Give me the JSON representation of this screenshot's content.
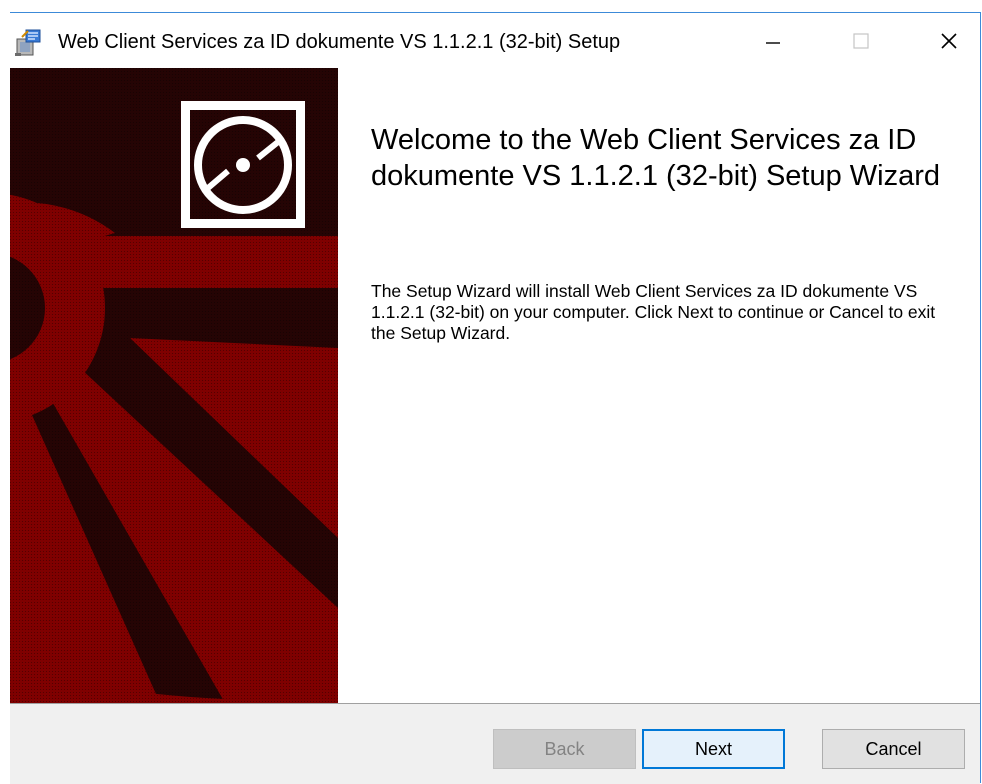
{
  "window": {
    "title": "Web Client Services za ID dokumente VS 1.1.2.1 (32-bit) Setup",
    "accent_color": "#0078d7",
    "sidebar_color": "#7f0000"
  },
  "titlebar_icons": {
    "app": "installer-icon",
    "minimize": "minimize-icon",
    "maximize": "maximize-icon",
    "close": "close-icon"
  },
  "main": {
    "heading": "Welcome to the Web Client Services za ID dokumente VS 1.1.2.1 (32-bit) Setup Wizard",
    "body": "The Setup Wizard will install Web Client Services za ID dokumente VS 1.1.2.1 (32-bit) on your computer. Click Next to continue or Cancel to exit the Setup Wizard."
  },
  "sidebar": {
    "logo_icon": "disc-icon"
  },
  "footer": {
    "back_label": "Back",
    "next_label": "Next",
    "cancel_label": "Cancel"
  }
}
